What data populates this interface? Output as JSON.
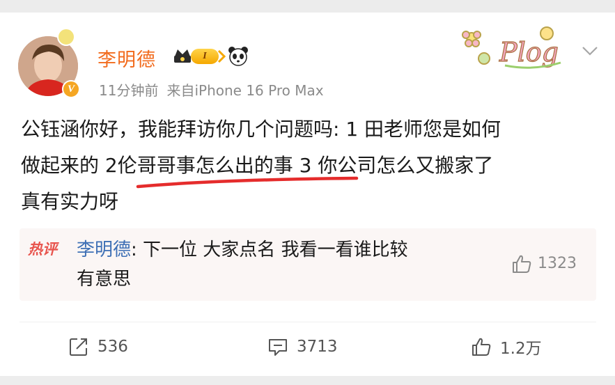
{
  "post": {
    "author": "李明德",
    "level": "I",
    "time": "11分钟前",
    "source": "来自iPhone 16 Pro Max",
    "sticker_text": "Plog",
    "content_lines": [
      "公钰涵你好，我能拜访你几个问题吗: 1 田老师您是如何",
      "做起来的 2伦哥哥事怎么出的事 3 你公司怎么又搬家了",
      "真有实力呀"
    ]
  },
  "hot_comment": {
    "label": "热评",
    "author": "李明德",
    "separator": ": ",
    "text_line1": "下一位 大家点名 我看一看谁比较",
    "text_line2": "有意思",
    "likes": "1323"
  },
  "actions": {
    "repost": "536",
    "comments": "3713",
    "likes": "1.2万"
  },
  "colors": {
    "username": "#f26b1d",
    "hot_label": "#e8554e",
    "link_blue": "#3d6fb5",
    "underline_red": "#e52c2c",
    "meta_gray": "#8a8a8a"
  },
  "icons": {
    "avatar_badge": "badge-icon",
    "verified": "verified-v-icon",
    "crown": "crown-icon",
    "panda": "panda-icon",
    "chevron": "chevron-down-icon",
    "repost": "repost-icon",
    "comment": "comment-icon",
    "like": "thumbs-up-icon"
  }
}
